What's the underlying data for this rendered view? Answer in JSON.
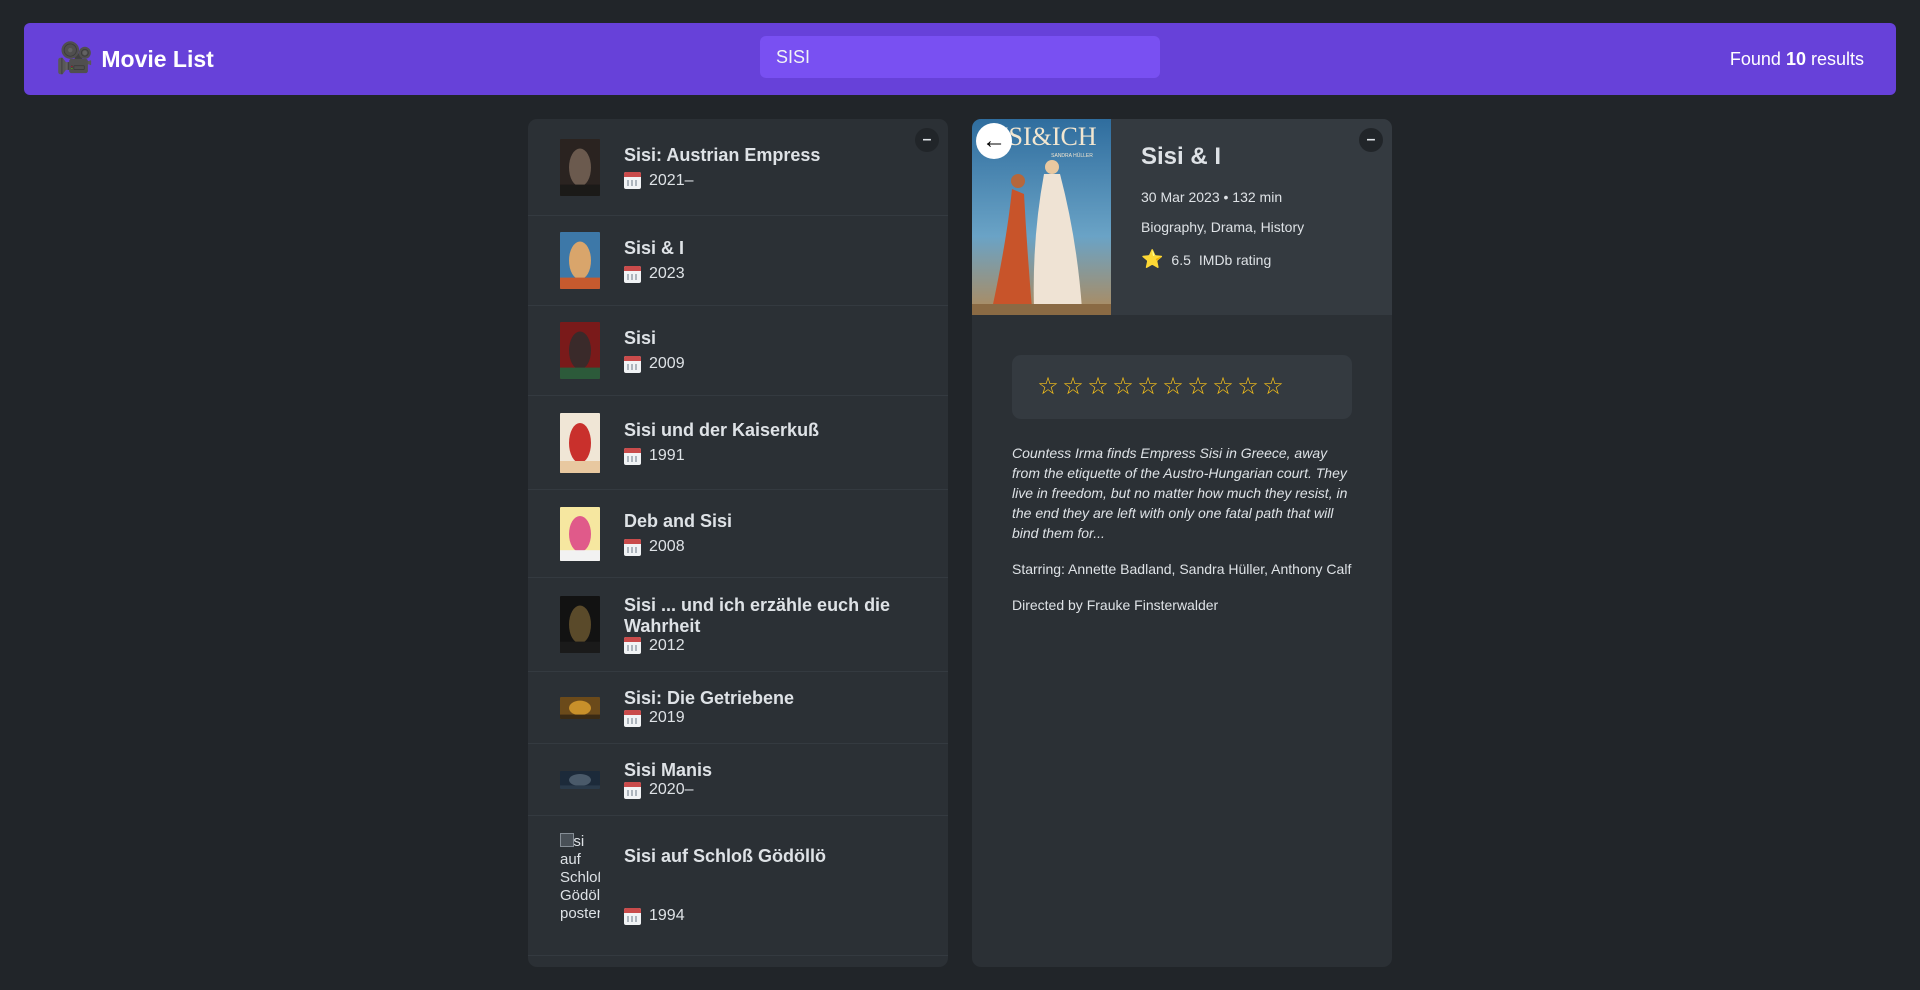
{
  "header": {
    "logo_icon": "🎥",
    "app_title": "Movie List",
    "search_value": "SISI",
    "results_prefix": "Found",
    "results_count": "10",
    "results_suffix": "results"
  },
  "list_toggle_label": "–",
  "details_toggle_label": "–",
  "movies": [
    {
      "title": "Sisi: Austrian Empress",
      "year": "2021–",
      "poster_colors": [
        "#2a2320",
        "#6b5a4e",
        "#1b1a18"
      ]
    },
    {
      "title": "Sisi & I",
      "year": "2023",
      "poster_colors": [
        "#3d78a8",
        "#d9a56b",
        "#c65a2e"
      ]
    },
    {
      "title": "Sisi",
      "year": "2009",
      "poster_colors": [
        "#7a1a1a",
        "#3a2a2a",
        "#2c5a3a"
      ]
    },
    {
      "title": "Sisi und der Kaiserkuß",
      "year": "1991",
      "poster_colors": [
        "#f0e6d6",
        "#c9302c",
        "#e8c8a0"
      ]
    },
    {
      "title": "Deb and Sisi",
      "year": "2008",
      "poster_colors": [
        "#f6e7a0",
        "#e05a8a",
        "#f2f2f2"
      ]
    },
    {
      "title": "Sisi ... und ich erzähle euch die Wahrheit",
      "year": "2012",
      "poster_colors": [
        "#121212",
        "#5a4a2a",
        "#1a1a1a"
      ]
    },
    {
      "title": "Sisi: Die Getriebene",
      "year": "2019",
      "poster_colors": [
        "#6b4a1a",
        "#c8902a",
        "#3a2a14"
      ]
    },
    {
      "title": "Sisi Manis",
      "year": "2020–",
      "poster_colors": [
        "#1c2a3a",
        "#4a5a6a",
        "#2a3a4a"
      ]
    },
    {
      "title": "Sisi auf Schloß Gödöllö",
      "year": "1994",
      "poster_alt": "Sisi auf Schloß Gödöllö poster"
    }
  ],
  "details": {
    "title": "Sisi & I",
    "released": "30 Mar 2023",
    "runtime": "132 min",
    "genre": "Biography, Drama, History",
    "imdb_rating": "6.5",
    "imdb_label": "IMDb rating",
    "rating_star_icon": "⭐",
    "back_label": "←",
    "poster_title": "SISI&ICH",
    "poster_cast": "SANDRA HÜLLER",
    "stars_count": 10,
    "plot": "Countess Irma finds Empress Sisi in Greece, away from the etiquette of the Austro-Hungarian court. They live in freedom, but no matter how much they resist, in the end they are left with only one fatal path that will bind them for...",
    "starring": "Starring: Annette Badland, Sandra Hüller, Anthony Calf",
    "director": "Directed by Frauke Finsterwalder"
  },
  "colors": {
    "background": "#212529",
    "primary": "#6741d9",
    "primary_light": "#7950f2",
    "box": "#2b3035",
    "star": "#fcc419"
  }
}
